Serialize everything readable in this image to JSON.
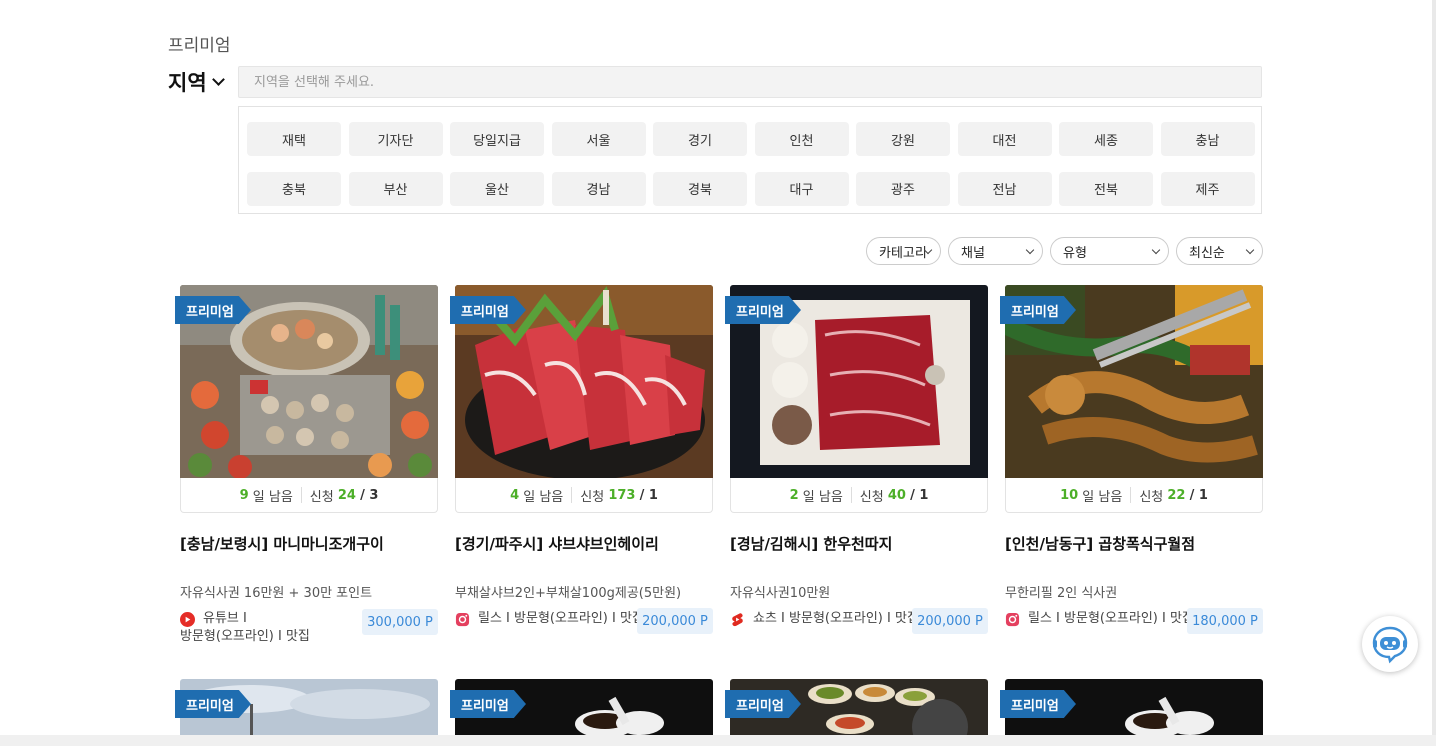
{
  "section_title": "프리미엄",
  "region": {
    "title": "지역",
    "placeholder": "지역을 선택해 주세요.",
    "chips": [
      "재택",
      "기자단",
      "당일지급",
      "서울",
      "경기",
      "인천",
      "강원",
      "대전",
      "세종",
      "충남",
      "충북",
      "부산",
      "울산",
      "경남",
      "경북",
      "대구",
      "광주",
      "전남",
      "전북",
      "제주"
    ]
  },
  "filters": {
    "category": "카테고리",
    "channel": "채널",
    "type": "유형",
    "sort": "최신순"
  },
  "labels": {
    "badge": "프리미엄",
    "days_left": "일 남음",
    "applied": "신청"
  },
  "cards": [
    {
      "days": "9",
      "applied": "24",
      "capacity": "/ 3",
      "title": "[충남/보령시] 마니마니조개구이",
      "desc": "자유식사권 16만원 + 30만 포인트",
      "meta_line1": "유튜브 I",
      "meta_line2": "방문형(오프라인) I 맛집",
      "channel_icon": "youtube-icon",
      "points": "300,000 P"
    },
    {
      "days": "4",
      "applied": "173",
      "capacity": "/ 1",
      "title": "[경기/파주시] 샤브샤브인헤이리",
      "desc": "부채살샤브2인+부채살100g제공(5만원)",
      "meta_line1": "릴스 I 방문형(오프라인) I 맛집",
      "channel_icon": "instagram-icon",
      "points": "200,000 P"
    },
    {
      "days": "2",
      "applied": "40",
      "capacity": "/ 1",
      "title": "[경남/김해시] 한우천따지",
      "desc": "자유식사권10만원",
      "meta_line1": "쇼츠 I 방문형(오프라인) I 맛집",
      "channel_icon": "shorts-icon",
      "points": "200,000 P"
    },
    {
      "days": "10",
      "applied": "22",
      "capacity": "/ 1",
      "title": "[인천/남동구] 곱창폭식구월점",
      "desc": "무한리필 2인 식사권",
      "meta_line1": "릴스 I 방문형(오프라인) I 맛집",
      "channel_icon": "instagram-icon",
      "points": "180,000 P"
    }
  ],
  "colors": {
    "badge": "#1f6db0",
    "days_green": "#4caf28",
    "points_bg": "#e8f1fa",
    "points_text": "#3b8ad8"
  }
}
